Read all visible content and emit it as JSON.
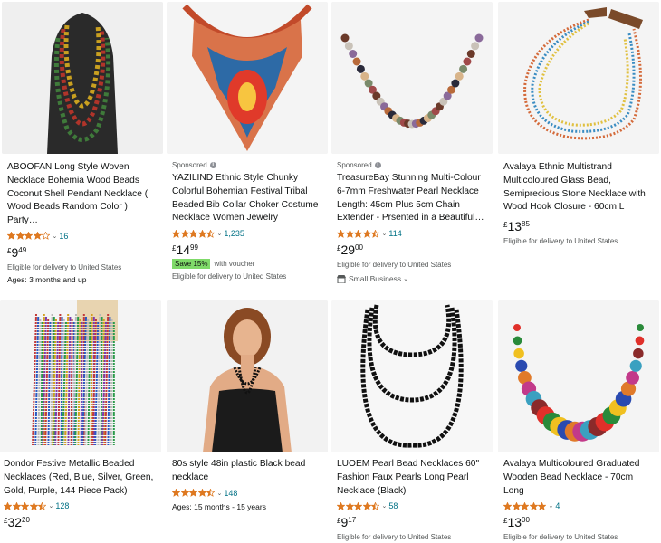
{
  "products": [
    {
      "sponsored": "",
      "title": "ABOOFAN Long Style Woven Necklace Bohemia Wood Beads Coconut Shell Pendant Necklace ( Wood Beads Random Color ) Party…",
      "rating": 4.0,
      "reviews": "16",
      "price": {
        "symbol": "£",
        "whole": "9",
        "fraction": "49"
      },
      "eligible": "Eligible for delivery to United States",
      "extra": "Ages: 3 months and up"
    },
    {
      "sponsored": "Sponsored",
      "title": "YAZILIND Ethnic Style Chunky Colorful Bohemian Festival Tribal Beaded Bib Collar Choker Costume Necklace Women Jewelry",
      "rating": 4.5,
      "reviews": "1,235",
      "price": {
        "symbol": "£",
        "whole": "14",
        "fraction": "99"
      },
      "save_badge": "Save 15%",
      "save_text": "with voucher",
      "eligible": "Eligible for delivery to United States"
    },
    {
      "sponsored": "Sponsored",
      "title": "TreasureBay Stunning Multi-Colour 6-7mm Freshwater Pearl Necklace Length: 45cm Plus 5cm Chain Extender - Prsented in a Beautiful…",
      "rating": 4.5,
      "reviews": "114",
      "price": {
        "symbol": "£",
        "whole": "29",
        "fraction": "00"
      },
      "eligible": "Eligible for delivery to United States",
      "small_business": "Small Business"
    },
    {
      "sponsored": "",
      "title": "Avalaya Ethnic Multistrand Multicoloured Glass Bead, Semiprecious Stone Necklace with Wood Hook Closure - 60cm L",
      "price": {
        "symbol": "£",
        "whole": "13",
        "fraction": "85"
      },
      "eligible": "Eligible for delivery to United States"
    },
    {
      "sponsored": "",
      "title": "Dondor Festive Metallic Beaded Necklaces (Red, Blue, Silver, Green, Gold, Purple, 144 Piece Pack)",
      "rating": 4.5,
      "reviews": "128",
      "price": {
        "symbol": "£",
        "whole": "32",
        "fraction": "20"
      }
    },
    {
      "sponsored": "",
      "title": "80s style 48in plastic Black bead necklace",
      "rating": 4.5,
      "reviews": "148",
      "extra": "Ages: 15 months - 15 years"
    },
    {
      "sponsored": "",
      "title": "LUOEM Pearl Bead Necklaces 60\" Fashion Faux Pearls Long Pearl Necklace (Black)",
      "rating": 4.5,
      "reviews": "58",
      "price": {
        "symbol": "£",
        "whole": "9",
        "fraction": "17"
      },
      "eligible": "Eligible for delivery to United States"
    },
    {
      "sponsored": "",
      "title": "Avalaya Multicoloured Graduated Wooden Bead Necklace - 70cm Long",
      "rating": 5.0,
      "reviews": "4",
      "price": {
        "symbol": "£",
        "whole": "13",
        "fraction": "00"
      },
      "eligible": "Eligible for delivery to United States"
    }
  ],
  "colors": {
    "star": "#de7921",
    "star_empty": "#ffffff",
    "link": "#007185",
    "badge": "#7fda69",
    "image_bg": "#f3f3f3"
  }
}
